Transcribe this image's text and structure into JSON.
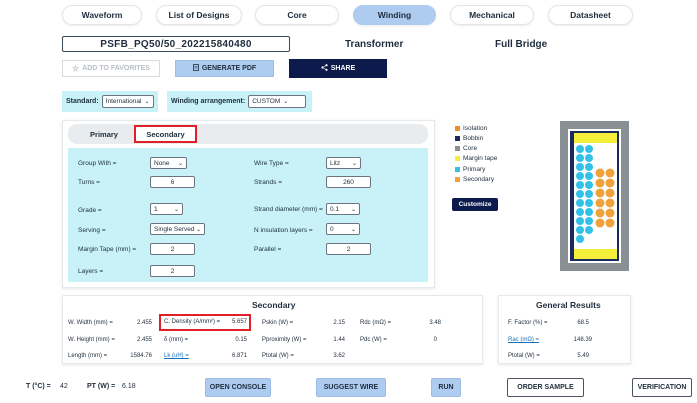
{
  "nav": {
    "tabs": [
      {
        "label": "Waveform"
      },
      {
        "label": "List of Designs"
      },
      {
        "label": "Core"
      },
      {
        "label": "Winding"
      },
      {
        "label": "Mechanical"
      },
      {
        "label": "Datasheet"
      }
    ],
    "active": "Winding"
  },
  "header": {
    "design_name": "PSFB_PQ50/50_202215840480",
    "type": "Transformer",
    "topology": "Full Bridge"
  },
  "actions": {
    "favorites": "ADD TO FAVORITES",
    "generate_pdf": "GENERATE PDF",
    "share": "SHARE"
  },
  "settings": {
    "standard_label": "Standard:",
    "standard_value": "International",
    "winding_label": "Winding arrangement:",
    "winding_value": "CUSTOM"
  },
  "winding_tabs": {
    "primary": "Primary",
    "secondary": "Secondary"
  },
  "form": {
    "group_with_label": "Group With =",
    "group_with_value": "None",
    "turns_label": "Turns =",
    "turns_value": "6",
    "grade_label": "Grade =",
    "grade_value": "1",
    "serving_label": "Serving =",
    "serving_value": "Single Served",
    "margin_tape_label": "Margin Tape (mm) =",
    "margin_tape_value": "2",
    "layers_label": "Layers =",
    "layers_value": "2",
    "wire_type_label": "Wire Type =",
    "wire_type_value": "Litz",
    "strands_label": "Strands =",
    "strands_value": "260",
    "strand_diameter_label": "Strand diameter (mm) =",
    "strand_diameter_value": "0.1",
    "insulation_layers_label": "N insulation layers =",
    "insulation_layers_value": "0",
    "parallel_label": "Parallel =",
    "parallel_value": "2"
  },
  "legend": [
    {
      "label": "Isolation",
      "color": "#f28c28"
    },
    {
      "label": "Bobbin",
      "color": "#1a2a5c"
    },
    {
      "label": "Core",
      "color": "#8a8f96"
    },
    {
      "label": "Margin tape",
      "color": "#f3ef3a"
    },
    {
      "label": "Primary",
      "color": "#33c1e8"
    },
    {
      "label": "Secondary",
      "color": "#f0a23a"
    }
  ],
  "customize": "Customize",
  "secondary_results": {
    "title": "Secondary",
    "w_width_label": "W. Width (mm) =",
    "w_width_value": "2.455",
    "w_height_label": "W. Height (mm) =",
    "w_height_value": "2.455",
    "length_label": "Length (mm) =",
    "length_value": "1584.76",
    "c_density_label": "C. Density (A/mm²) =",
    "c_density_value": "5.657",
    "delta_label": "δ (mm) =",
    "delta_value": "0.15",
    "lk_label": "Lk (uH) =",
    "lk_value": "6.871",
    "pskin_label": "Pskin (W) =",
    "pskin_value": "2.15",
    "pproximity_label": "Pproximity (W) =",
    "pproximity_value": "1.44",
    "ptotal_label": "Ptotal (W) =",
    "ptotal_value": "3.62",
    "rdc_label": "Rdc (mΩ) =",
    "rdc_value": "3.48",
    "pdc_label": "Pdc (W) =",
    "pdc_value": "0"
  },
  "general_results": {
    "title": "General Results",
    "ffactor_label": "F. Factor (%) =",
    "ffactor_value": "68.5",
    "rac_label": "Rac (mΩ) =",
    "rac_value": "148.39",
    "ptotal_label": "Ptotal (W) =",
    "ptotal_value": "5.49"
  },
  "footer": {
    "t_label": "T (°C) =",
    "t_value": "42",
    "pt_label": "PT (W) =",
    "pt_value": "6.18",
    "open_console": "OPEN CONSOLE",
    "suggest_wire": "SUGGEST WIRE",
    "run": "RUN",
    "order_sample": "ORDER SAMPLE",
    "verification": "VERIFICATION"
  }
}
